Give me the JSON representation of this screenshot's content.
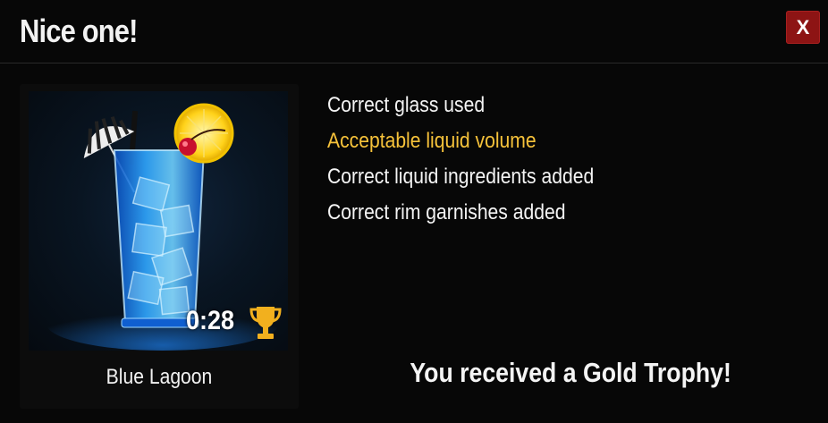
{
  "dialog": {
    "title": "Nice one!",
    "close_label": "X"
  },
  "drink": {
    "name": "Blue Lagoon",
    "time": "0:28",
    "trophy_icon": "gold-trophy-icon",
    "trophy_color": "#f2b01e"
  },
  "results": [
    {
      "text": "Correct glass used",
      "status": "correct",
      "color": "#f4f4f4"
    },
    {
      "text": "Acceptable liquid volume",
      "status": "acceptable",
      "color": "#f6c23a"
    },
    {
      "text": "Correct liquid ingredients added",
      "status": "correct",
      "color": "#f4f4f4"
    },
    {
      "text": "Correct rim garnishes added",
      "status": "correct",
      "color": "#f4f4f4"
    }
  ],
  "award": {
    "message": "You received a Gold Trophy!"
  },
  "colors": {
    "close_button": "#8d1414",
    "drink_blue": "#1f8ff0"
  }
}
